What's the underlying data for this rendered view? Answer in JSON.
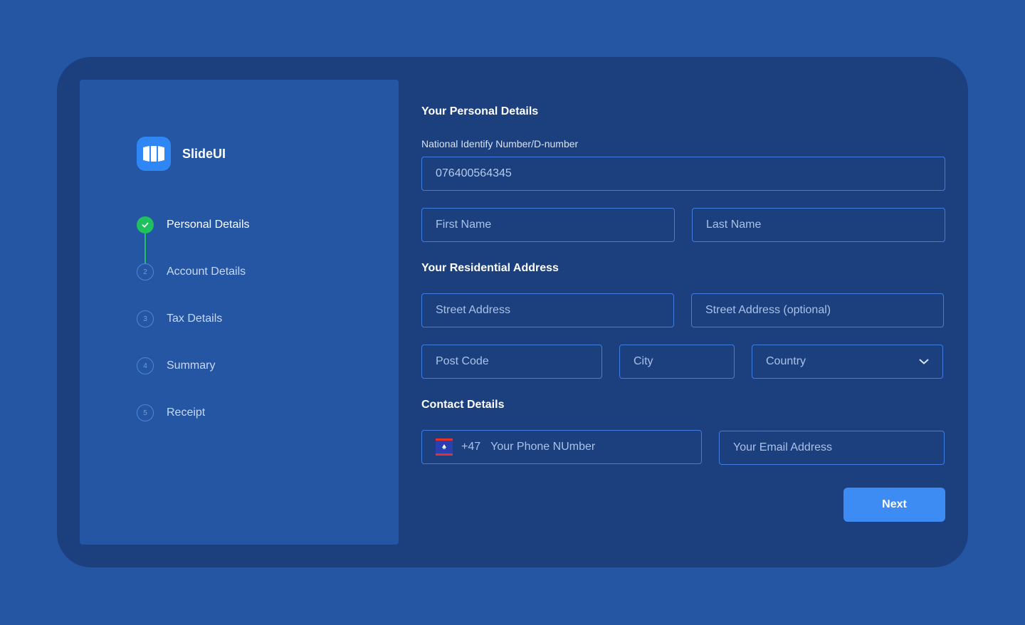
{
  "brand": {
    "name": "SlideUI"
  },
  "steps": [
    {
      "number": "1",
      "label": "Personal Details",
      "status": "done"
    },
    {
      "number": "2",
      "label": "Account Details",
      "status": "pending"
    },
    {
      "number": "3",
      "label": "Tax Details",
      "status": "pending"
    },
    {
      "number": "4",
      "label": "Summary",
      "status": "pending"
    },
    {
      "number": "5",
      "label": "Receipt",
      "status": "pending"
    }
  ],
  "personal": {
    "title": "Your Personal Details",
    "national_id_label": "National Identify Number/D-number",
    "national_id_value": "076400564345",
    "first_name_placeholder": "First Name",
    "last_name_placeholder": "Last Name"
  },
  "address": {
    "title": "Your Residential Address",
    "street_placeholder": "Street Address",
    "street_optional_placeholder": "Street Address (optional)",
    "post_code_placeholder": "Post Code",
    "city_placeholder": "City",
    "country_placeholder": "Country"
  },
  "contact": {
    "title": "Contact Details",
    "dial_code": "+47",
    "phone_placeholder": "Your Phone NUmber",
    "email_placeholder": "Your Email Address"
  },
  "actions": {
    "next_label": "Next"
  },
  "icons": {
    "logo": "columns-logo-icon",
    "step_done": "checkmark-icon",
    "flag": "flag-icon",
    "dropdown": "chevron-down-icon"
  },
  "colors": {
    "background": "#2456A4",
    "card": "#1C3F7E",
    "field_border": "#3D7EE0",
    "primary": "#3C8CF3",
    "success": "#1FC05D"
  }
}
